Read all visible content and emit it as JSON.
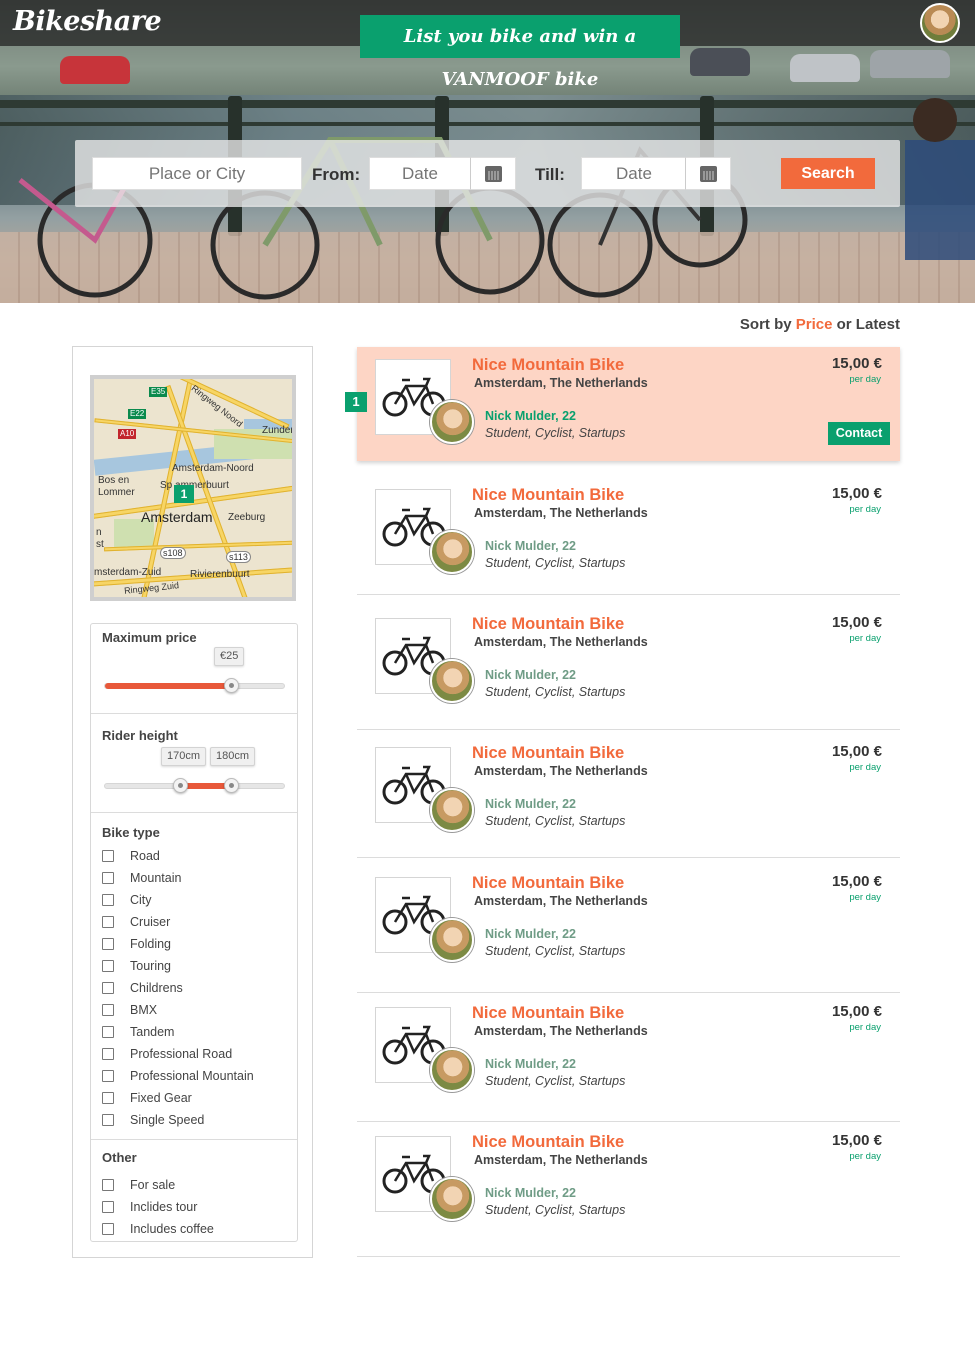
{
  "app": {
    "logo": "Bikeshare"
  },
  "header": {
    "promo": "List you bike and win a VANMOOF bike",
    "avatar": "user-avatar"
  },
  "search": {
    "place_placeholder": "Place or City",
    "from_label": "From:",
    "from_placeholder": "Date",
    "till_label": "Till:",
    "till_placeholder": "Date",
    "button": "Search",
    "calendar_icon": "calendar-icon"
  },
  "sort": {
    "prefix": "Sort by",
    "price": "Price",
    "or": "or Latest"
  },
  "map": {
    "marker": "1",
    "labels": {
      "e35": "E35",
      "e22": "E22",
      "a10": "A10",
      "ringweg_noord": "Ringweg Noord",
      "zunder": "Zunder",
      "amsterdam_noord": "Amsterdam-Noord",
      "bos_en": "Bos en",
      "lommer": "Lommer",
      "spaarndammerbuurt": "Sp    ammerbuurt",
      "amsterdam": "Amsterdam",
      "zeeburg": "Zeeburg",
      "s108": "s108",
      "s113": "s113",
      "n": "n",
      "st": "st",
      "amsterdam_zuid": "msterdam-Zuid",
      "rivierenbuurt": "Rivierenbuurt",
      "ringweg_zuid": "Ringweg Zuid"
    }
  },
  "filters": {
    "max_price": {
      "title": "Maximum price",
      "value": "€25",
      "fraction": 0.7
    },
    "rider_height": {
      "title": "Rider height",
      "min": "170cm",
      "max": "180cm",
      "min_fraction": 0.42,
      "max_fraction": 0.7
    },
    "bike_type": {
      "title": "Bike type",
      "items": [
        "Road",
        "Mountain",
        "City",
        "Cruiser",
        "Folding",
        "Touring",
        "Childrens",
        "BMX",
        "Tandem",
        "Professional Road",
        "Professional Mountain",
        "Fixed Gear",
        "Single Speed"
      ]
    },
    "other": {
      "title": "Other",
      "items": [
        "For sale",
        "Inclides tour",
        "Includes coffee"
      ]
    }
  },
  "listings": {
    "pin": "1",
    "contact": "Contact",
    "items": [
      {
        "title": "Nice Mountain Bike",
        "location": "Amsterdam, The Netherlands",
        "owner": "Nick Mulder, 22",
        "tags": "Student, Cyclist, Startups",
        "price": "15,00 €",
        "per": "per day"
      },
      {
        "title": "Nice Mountain Bike",
        "location": "Amsterdam, The Netherlands",
        "owner": "Nick Mulder, 22",
        "tags": "Student, Cyclist, Startups",
        "price": "15,00 €",
        "per": "per day"
      },
      {
        "title": "Nice Mountain Bike",
        "location": "Amsterdam, The Netherlands",
        "owner": "Nick Mulder, 22",
        "tags": "Student, Cyclist, Startups",
        "price": "15,00 €",
        "per": "per day"
      },
      {
        "title": "Nice Mountain Bike",
        "location": "Amsterdam, The Netherlands",
        "owner": "Nick Mulder, 22",
        "tags": "Student, Cyclist, Startups",
        "price": "15,00 €",
        "per": "per day"
      },
      {
        "title": "Nice Mountain Bike",
        "location": "Amsterdam, The Netherlands",
        "owner": "Nick Mulder, 22",
        "tags": "Student, Cyclist, Startups",
        "price": "15,00 €",
        "per": "per day"
      },
      {
        "title": "Nice Mountain Bike",
        "location": "Amsterdam, The Netherlands",
        "owner": "Nick Mulder, 22",
        "tags": "Student, Cyclist, Startups",
        "price": "15,00 €",
        "per": "per day"
      },
      {
        "title": "Nice Mountain Bike",
        "location": "Amsterdam, The Netherlands",
        "owner": "Nick Mulder, 22",
        "tags": "Student, Cyclist, Startups",
        "price": "15,00 €",
        "per": "per day"
      }
    ]
  },
  "colors": {
    "accent": "#f26a3c",
    "brand_green": "#0aa06e",
    "active_row": "#fdd5c5"
  }
}
